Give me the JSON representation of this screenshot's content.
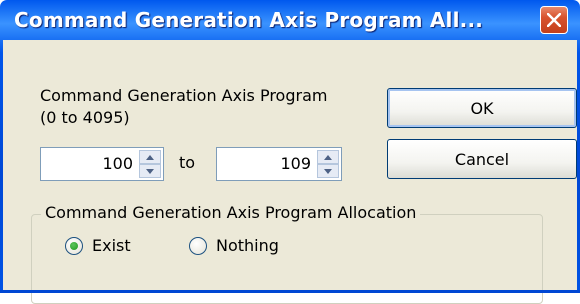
{
  "window": {
    "title": "Command Generation Axis Program All...",
    "close_label": "close"
  },
  "range": {
    "label_line1": "Command Generation Axis Program",
    "label_line2": "(0 to 4095)",
    "from_value": "100",
    "to_label": "to",
    "to_value": "109"
  },
  "buttons": {
    "ok_label": "OK",
    "cancel_label": "Cancel"
  },
  "allocation": {
    "group_title": "Command Generation Axis Program Allocation",
    "options": [
      {
        "label": "Exist",
        "selected": true
      },
      {
        "label": "Nothing",
        "selected": false
      }
    ]
  },
  "colors": {
    "titlebar": "#0055ea",
    "client_bg": "#ece9d8",
    "close_button": "#d8532e",
    "radio_selected": "#1f9a1f"
  }
}
